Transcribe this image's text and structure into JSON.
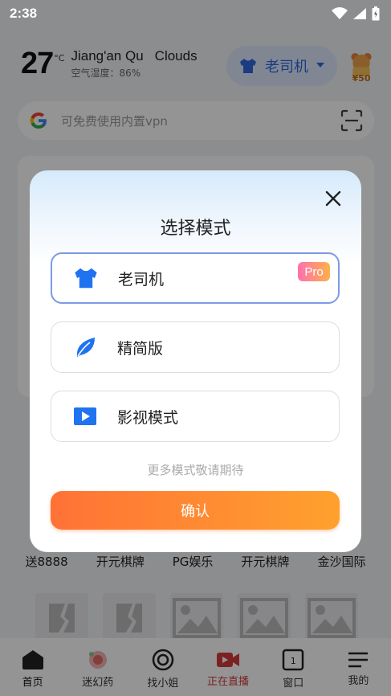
{
  "status_bar": {
    "time": "2:38"
  },
  "weather": {
    "temperature": "27",
    "unit": "°C",
    "location": "Jiang'an Qu",
    "condition": "Clouds",
    "humidity": "空气湿度：86%"
  },
  "header": {
    "mode_button_label": "老司机",
    "red_packet_amount": "¥50"
  },
  "search": {
    "placeholder": "可免费使用内置vpn"
  },
  "grid_labels": [
    "送8888",
    "开元棋牌",
    "PG娱乐",
    "开元棋牌",
    "金沙国际"
  ],
  "tabs": [
    {
      "label": "首页",
      "icon": "home-icon"
    },
    {
      "label": "迷幻药",
      "icon": "flower-icon"
    },
    {
      "label": "找小姐",
      "icon": "target-icon"
    },
    {
      "label": "正在直播",
      "icon": "video-camera-icon"
    },
    {
      "label": "窗口",
      "icon": "window-icon",
      "count": "1"
    },
    {
      "label": "我的",
      "icon": "menu-icon"
    }
  ],
  "modal": {
    "title": "选择模式",
    "options": [
      {
        "label": "老司机",
        "icon": "shirt-icon",
        "badge": "Pro",
        "selected": true
      },
      {
        "label": "精简版",
        "icon": "leaf-icon",
        "selected": false
      },
      {
        "label": "影视模式",
        "icon": "play-icon",
        "selected": false
      }
    ],
    "hint": "更多模式敬请期待",
    "confirm_label": "确认"
  },
  "colors": {
    "accent": "#2f66e0",
    "confirm_start": "#ff7236",
    "confirm_end": "#ffa12e",
    "selected_border": "#7d9ae6"
  }
}
